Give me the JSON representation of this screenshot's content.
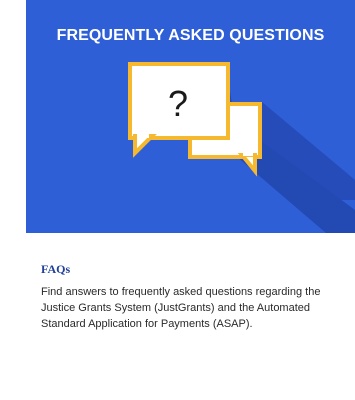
{
  "banner": {
    "title": "FREQUENTLY ASKED QUESTIONS",
    "icon_glyph": "?",
    "background_color": "#2e5fd6",
    "shadow_color": "#2349b3",
    "bubble_border_color": "#f5b82e",
    "bubble_fill_color": "#ffffff"
  },
  "content": {
    "link_label": "FAQs",
    "description": "Find answers to frequently asked questions regarding the Justice Grants System (JustGrants) and the Automated Standard Application for Payments (ASAP)."
  }
}
